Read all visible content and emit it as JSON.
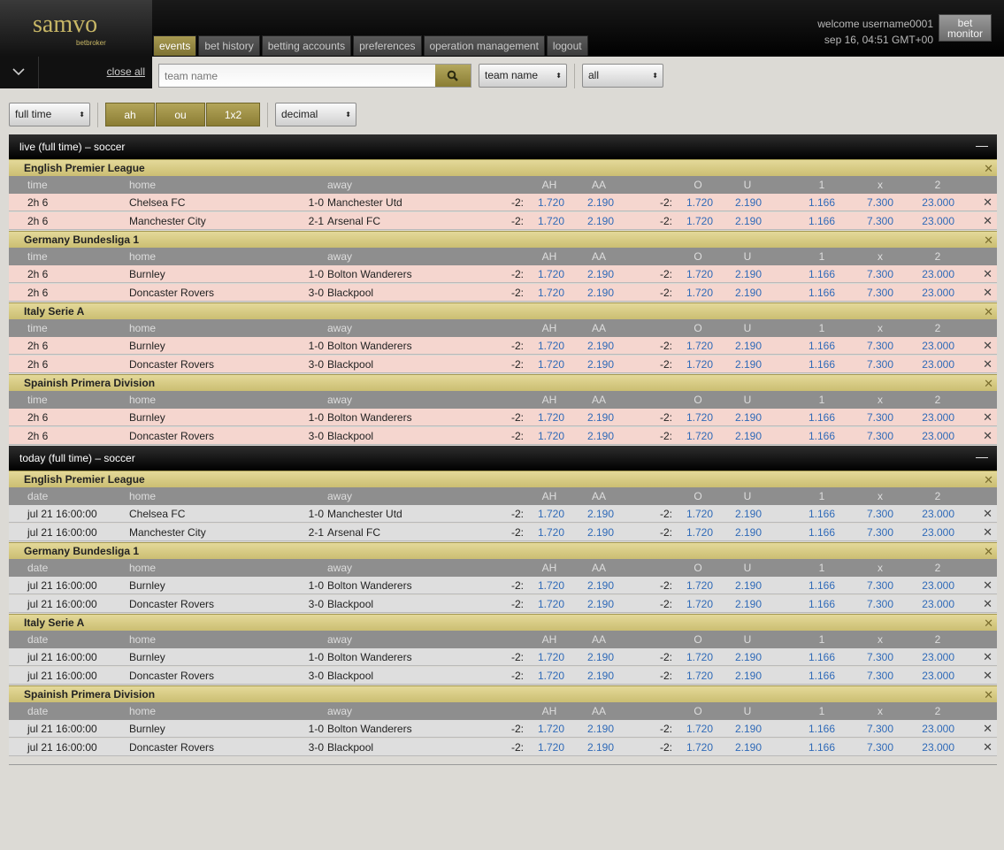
{
  "brand": {
    "logo": "samvo",
    "sub": "betbroker"
  },
  "nav": [
    "events",
    "bet history",
    "betting accounts",
    "preferences",
    "operation management",
    "logout"
  ],
  "user": {
    "welcome": "welcome username0001",
    "datetime": "sep 16, 04:51 GMT+00",
    "monitor_button": "bet monitor"
  },
  "toolbar": {
    "close_all": "close all",
    "search_placeholder": "team name",
    "search_by": "team name",
    "filter": "all",
    "period": "full time",
    "odds_types": [
      "ah",
      "ou",
      "1x2"
    ],
    "format": "decimal"
  },
  "columns": {
    "live": [
      "time",
      "home",
      "away",
      "AH",
      "AA",
      "O",
      "U",
      "1",
      "x",
      "2"
    ],
    "today": [
      "date",
      "home",
      "away",
      "AH",
      "AA",
      "O",
      "U",
      "1",
      "x",
      "2"
    ]
  },
  "sections": [
    {
      "title": "live (full time) – soccer",
      "kind": "live",
      "leagues": [
        {
          "name": "English Premier League",
          "events": [
            {
              "time": "2h 6",
              "home": "Chelsea FC",
              "score": "1-0",
              "away": "Manchester Utd",
              "hdp": "-2:",
              "ah": "1.720",
              "aa": "2.190",
              "ou": "-2:",
              "o": "1.720",
              "u": "2.190",
              "one": "1.166",
              "x": "7.300",
              "two": "23.000"
            },
            {
              "time": "2h 6",
              "home": "Manchester City",
              "score": "2-1",
              "away": "Arsenal FC",
              "hdp": "-2:",
              "ah": "1.720",
              "aa": "2.190",
              "ou": "-2:",
              "o": "1.720",
              "u": "2.190",
              "one": "1.166",
              "x": "7.300",
              "two": "23.000"
            }
          ]
        },
        {
          "name": "Germany Bundesliga 1",
          "events": [
            {
              "time": "2h 6",
              "home": "Burnley",
              "score": "1-0",
              "away": "Bolton Wanderers",
              "hdp": "-2:",
              "ah": "1.720",
              "aa": "2.190",
              "ou": "-2:",
              "o": "1.720",
              "u": "2.190",
              "one": "1.166",
              "x": "7.300",
              "two": "23.000"
            },
            {
              "time": "2h 6",
              "home": "Doncaster Rovers",
              "score": "3-0",
              "away": "Blackpool",
              "hdp": "-2:",
              "ah": "1.720",
              "aa": "2.190",
              "ou": "-2:",
              "o": "1.720",
              "u": "2.190",
              "one": "1.166",
              "x": "7.300",
              "two": "23.000"
            }
          ]
        },
        {
          "name": "Italy Serie A",
          "events": [
            {
              "time": "2h 6",
              "home": "Burnley",
              "score": "1-0",
              "away": "Bolton Wanderers",
              "hdp": "-2:",
              "ah": "1.720",
              "aa": "2.190",
              "ou": "-2:",
              "o": "1.720",
              "u": "2.190",
              "one": "1.166",
              "x": "7.300",
              "two": "23.000"
            },
            {
              "time": "2h 6",
              "home": "Doncaster Rovers",
              "score": "3-0",
              "away": "Blackpool",
              "hdp": "-2:",
              "ah": "1.720",
              "aa": "2.190",
              "ou": "-2:",
              "o": "1.720",
              "u": "2.190",
              "one": "1.166",
              "x": "7.300",
              "two": "23.000"
            }
          ]
        },
        {
          "name": "Spainish Primera Division",
          "events": [
            {
              "time": "2h 6",
              "home": "Burnley",
              "score": "1-0",
              "away": "Bolton Wanderers",
              "hdp": "-2:",
              "ah": "1.720",
              "aa": "2.190",
              "ou": "-2:",
              "o": "1.720",
              "u": "2.190",
              "one": "1.166",
              "x": "7.300",
              "two": "23.000"
            },
            {
              "time": "2h 6",
              "home": "Doncaster Rovers",
              "score": "3-0",
              "away": "Blackpool",
              "hdp": "-2:",
              "ah": "1.720",
              "aa": "2.190",
              "ou": "-2:",
              "o": "1.720",
              "u": "2.190",
              "one": "1.166",
              "x": "7.300",
              "two": "23.000"
            }
          ]
        }
      ]
    },
    {
      "title": "today (full time) – soccer",
      "kind": "today",
      "leagues": [
        {
          "name": "English Premier League",
          "events": [
            {
              "time": "jul 21 16:00:00",
              "home": "Chelsea FC",
              "score": "1-0",
              "away": "Manchester Utd",
              "hdp": "-2:",
              "ah": "1.720",
              "aa": "2.190",
              "ou": "-2:",
              "o": "1.720",
              "u": "2.190",
              "one": "1.166",
              "x": "7.300",
              "two": "23.000"
            },
            {
              "time": "jul 21 16:00:00",
              "home": "Manchester City",
              "score": "2-1",
              "away": "Arsenal FC",
              "hdp": "-2:",
              "ah": "1.720",
              "aa": "2.190",
              "ou": "-2:",
              "o": "1.720",
              "u": "2.190",
              "one": "1.166",
              "x": "7.300",
              "two": "23.000"
            }
          ]
        },
        {
          "name": "Germany Bundesliga 1",
          "events": [
            {
              "time": "jul 21 16:00:00",
              "home": "Burnley",
              "score": "1-0",
              "away": "Bolton Wanderers",
              "hdp": "-2:",
              "ah": "1.720",
              "aa": "2.190",
              "ou": "-2:",
              "o": "1.720",
              "u": "2.190",
              "one": "1.166",
              "x": "7.300",
              "two": "23.000"
            },
            {
              "time": "jul 21 16:00:00",
              "home": "Doncaster Rovers",
              "score": "3-0",
              "away": "Blackpool",
              "hdp": "-2:",
              "ah": "1.720",
              "aa": "2.190",
              "ou": "-2:",
              "o": "1.720",
              "u": "2.190",
              "one": "1.166",
              "x": "7.300",
              "two": "23.000"
            }
          ]
        },
        {
          "name": "Italy Serie A",
          "events": [
            {
              "time": "jul 21 16:00:00",
              "home": "Burnley",
              "score": "1-0",
              "away": "Bolton Wanderers",
              "hdp": "-2:",
              "ah": "1.720",
              "aa": "2.190",
              "ou": "-2:",
              "o": "1.720",
              "u": "2.190",
              "one": "1.166",
              "x": "7.300",
              "two": "23.000"
            },
            {
              "time": "jul 21 16:00:00",
              "home": "Doncaster Rovers",
              "score": "3-0",
              "away": "Blackpool",
              "hdp": "-2:",
              "ah": "1.720",
              "aa": "2.190",
              "ou": "-2:",
              "o": "1.720",
              "u": "2.190",
              "one": "1.166",
              "x": "7.300",
              "two": "23.000"
            }
          ]
        },
        {
          "name": "Spainish Primera Division",
          "events": [
            {
              "time": "jul 21 16:00:00",
              "home": "Burnley",
              "score": "1-0",
              "away": "Bolton Wanderers",
              "hdp": "-2:",
              "ah": "1.720",
              "aa": "2.190",
              "ou": "-2:",
              "o": "1.720",
              "u": "2.190",
              "one": "1.166",
              "x": "7.300",
              "two": "23.000"
            },
            {
              "time": "jul 21 16:00:00",
              "home": "Doncaster Rovers",
              "score": "3-0",
              "away": "Blackpool",
              "hdp": "-2:",
              "ah": "1.720",
              "aa": "2.190",
              "ou": "-2:",
              "o": "1.720",
              "u": "2.190",
              "one": "1.166",
              "x": "7.300",
              "two": "23.000"
            }
          ]
        }
      ]
    }
  ]
}
